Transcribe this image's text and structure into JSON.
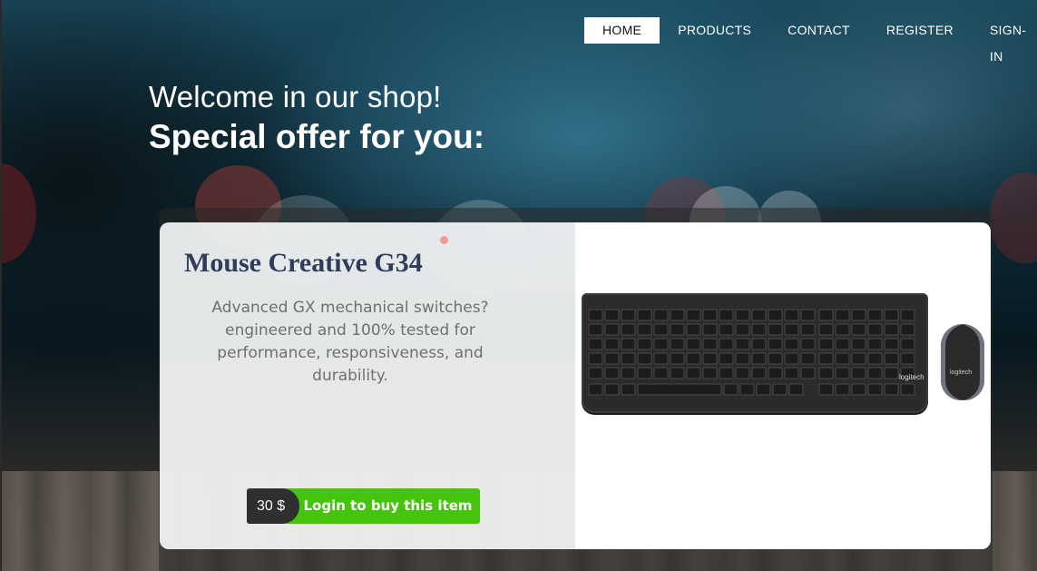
{
  "nav": {
    "items": [
      "HOME",
      "PRODUCTS",
      "CONTACT",
      "REGISTER",
      "SIGN-IN"
    ],
    "active": "HOME"
  },
  "hero": {
    "welcome": "Welcome in our shop!",
    "special": "Special offer for you:"
  },
  "product": {
    "title": "Mouse Creative G34",
    "description": "Advanced GX mechanical switches? engineered and 100% tested for performance, responsiveness, and durability.",
    "price": "30 $",
    "buy_label": "Login to buy this item",
    "brand": "logitech"
  },
  "colors": {
    "accent_green": "#44c40c",
    "title_navy": "#2f3c5a",
    "price_bg": "#2f2f2f"
  }
}
